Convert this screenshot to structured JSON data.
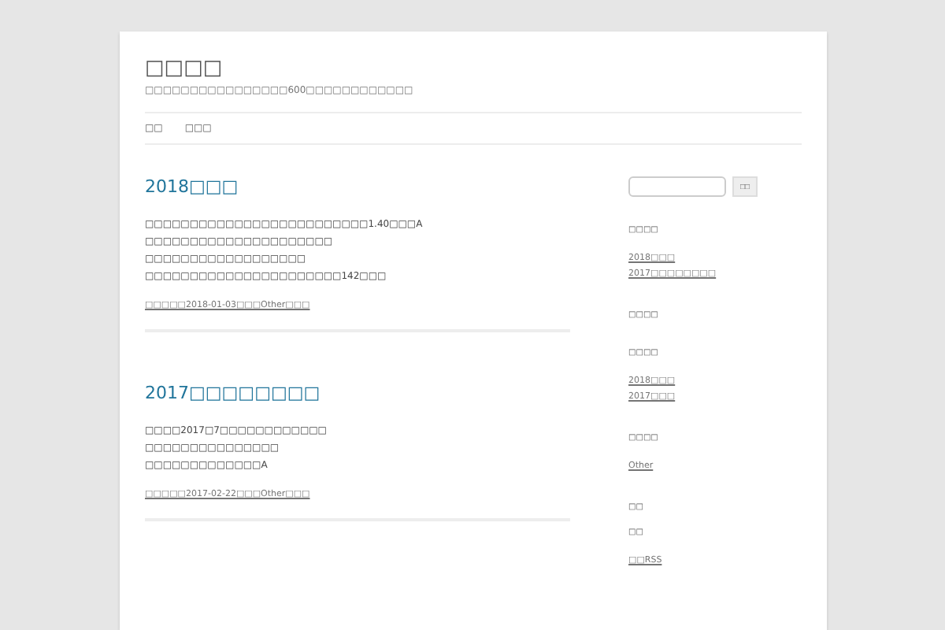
{
  "site": {
    "title": "□□□□",
    "tagline": "□□□□□□□□□□□□□□□□600□□□□□□□□□□□□"
  },
  "nav": [
    {
      "label": "□□"
    },
    {
      "label": "□□□"
    }
  ],
  "posts": [
    {
      "title": "2018□□□",
      "lines": [
        "□□□□□□□□□□□□□□□□□□□□□□□□□1.40□□□A",
        "□□□□□□□□□□□□□□□□□□□□□",
        "□□□□□□□□□□□□□□□□□□",
        "□□□□□□□□□□□□□□□□□□□□□□142□□□"
      ],
      "meta_prefix": "□□□□□",
      "date": "2018-01-03",
      "meta_mid": "□□□",
      "category": "Other",
      "meta_suffix": "□□□"
    },
    {
      "title": "2017□□□□□□□□",
      "lines": [
        "□□□□2017□7□□□□□□□□□□□□",
        "□□□□□□□□□□□□□□□",
        "□□□□□□□□□□□□□A"
      ],
      "meta_prefix": "□□□□□",
      "date": "2017-02-22",
      "meta_mid": "□□□",
      "category": "Other",
      "meta_suffix": "□□□"
    }
  ],
  "search": {
    "button": "□□"
  },
  "widgets": [
    {
      "title": "□□□□",
      "links": [
        "2018□□□",
        "2017□□□□□□□□"
      ]
    },
    {
      "title": "□□□□"
    },
    {
      "title": "□□□□",
      "links": [
        "2018□□□",
        "2017□□□"
      ]
    },
    {
      "title": "□□□□",
      "links": [
        "Other"
      ]
    },
    {
      "title": "□□"
    },
    {
      "title": "□□",
      "links": [
        "□□RSS"
      ]
    }
  ]
}
